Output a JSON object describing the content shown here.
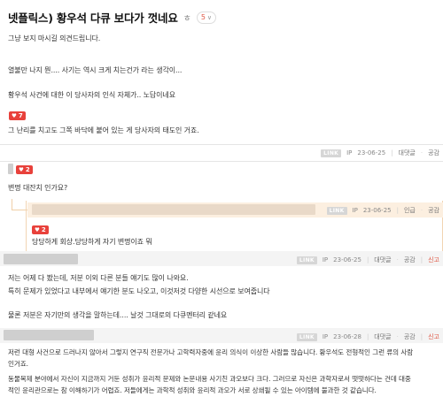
{
  "post": {
    "title": "넷플릭스) 황우석 다큐 보다가 껏네요",
    "reply_icon": "reply-icon",
    "comment_count": "5",
    "lines": [
      "그냥 보지 마시길 의견드립니다.",
      "열불만 나지 뭔.... 사기는 역시 크게 치는건가 라는 생각이...",
      "황우석 사건에 대한  이 당사자의 인식 자체가.. 노답이네요"
    ],
    "likes": "7",
    "last_line": "그 난리를 치고도 그쪽 바닥에 붙어 있는 게 당사자의 태도인 거죠.",
    "meta": {
      "link": "LINK",
      "ip": "IP",
      "date": "23-06-25",
      "reply": "대댓글",
      "sympathy": "공감"
    }
  },
  "comments": [
    {
      "likes": "2",
      "text": "변명 대잔치 인가요?",
      "meta": {
        "link": "LINK",
        "ip": "IP",
        "date": "23-06-25",
        "reply": "대댓글",
        "sympathy": "공감"
      }
    },
    {
      "text": "저는 어제 다 봤는데, 저분 이외 다른 분들 얘기도 많이 나와요.",
      "text2": "특히 문제가 있었다고 내부에서 얘기한 분도 나오고, 이것저것 다양한 시선으로 보여줍니다",
      "text3": "물론 저분은 자기만의 생각을 말하는데.... 날것 그대로의 다큐멘터리 같네요",
      "meta": {
        "link": "LINK",
        "ip": "IP",
        "date": "23-06-25",
        "reply": "대댓글",
        "sympathy": "공감",
        "report": "신고"
      }
    },
    {
      "text": "저런 대형 사건으로 드러나지 않아서 그렇지 연구직 전문가나 고학력자중에 윤리 의식이 이상한 사람들 많습니다. 황우석도 전형적인 그런 류의 사람",
      "text2": "인거죠.",
      "text3": "동물복제 분야에서 자신이 지금까지 거둔 성취가 윤리적 문제와 논문내용 사기친 과오보다 크다. 그러므로 자신은 과학자로서 떳떳하다는 건데 대중",
      "text4": "적인 윤리관으로는 참 이해하기가 어렵죠. 저들에게는 과학적 성취와 윤리적 과오가 서로 상쇄될 수 있는 아이템에 불과한 것 같습니다.",
      "meta": {
        "link": "LINK",
        "ip": "IP",
        "date": "23-06-28",
        "reply": "대댓글",
        "sympathy": "공감",
        "report": "신고"
      }
    }
  ],
  "reply": {
    "likes": "2",
    "text": "당당하게 회상.당당하게 자기 변명이죠 뭐",
    "meta": {
      "link": "LINK",
      "ip": "IP",
      "date": "23-06-25",
      "quote": "인급",
      "sympathy": "공감"
    }
  }
}
